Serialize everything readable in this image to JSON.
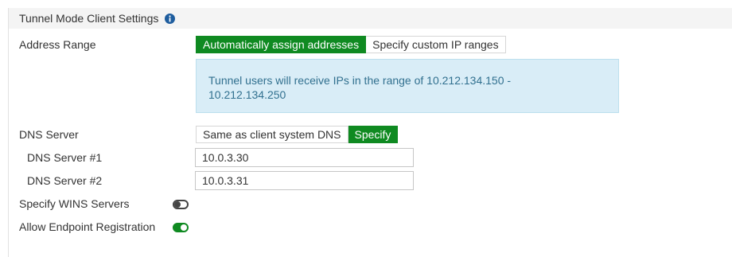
{
  "section": {
    "title": "Tunnel Mode Client Settings",
    "info_icon": "info-circle-icon"
  },
  "address_range": {
    "label": "Address Range",
    "options": [
      "Automatically assign addresses",
      "Specify custom IP ranges"
    ],
    "selected": "Automatically assign addresses",
    "info_line1": "Tunnel users will receive IPs in the range of 10.212.134.150 -",
    "info_line2": "10.212.134.250"
  },
  "dns": {
    "label": "DNS Server",
    "options": [
      "Same as client system DNS",
      "Specify"
    ],
    "selected": "Specify",
    "server1_label": "DNS Server #1",
    "server1_value": "10.0.3.30",
    "server2_label": "DNS Server #2",
    "server2_value": "10.0.3.31"
  },
  "wins": {
    "label": "Specify WINS Servers",
    "enabled": false
  },
  "endpoint": {
    "label": "Allow Endpoint Registration",
    "enabled": true
  },
  "colors": {
    "accent_green": "#0f8a21",
    "info_bg": "#d9edf7",
    "info_text": "#31708f",
    "header_bg": "#f4f4f4",
    "info_icon": "#1e5d9e"
  }
}
